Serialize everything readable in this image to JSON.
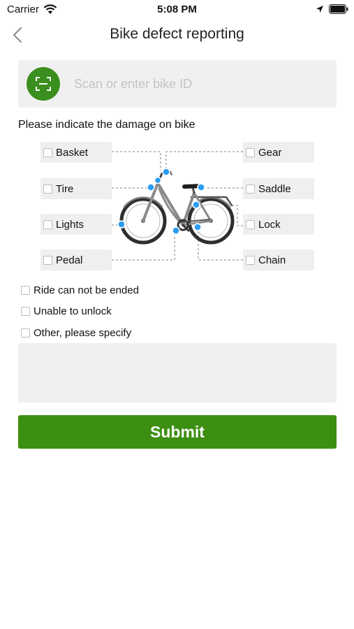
{
  "status_bar": {
    "carrier": "Carrier",
    "time": "5:08 PM",
    "icons": [
      "wifi-icon",
      "location-arrow-icon",
      "battery-icon"
    ]
  },
  "nav": {
    "title": "Bike defect reporting",
    "back_icon": "chevron-left-icon"
  },
  "scan": {
    "icon": "scan-icon",
    "placeholder": "Scan or enter bike ID",
    "value": ""
  },
  "damage": {
    "heading": "Please indicate the damage on bike",
    "parts_left": [
      {
        "label": "Basket",
        "checked": false
      },
      {
        "label": "Tire",
        "checked": false
      },
      {
        "label": "Lights",
        "checked": false
      },
      {
        "label": "Pedal",
        "checked": false
      }
    ],
    "parts_right": [
      {
        "label": "Gear",
        "checked": false
      },
      {
        "label": "Saddle",
        "checked": false
      },
      {
        "label": "Lock",
        "checked": false
      },
      {
        "label": "Chain",
        "checked": false
      }
    ]
  },
  "options": [
    {
      "label": "Ride can not be ended",
      "checked": false
    },
    {
      "label": "Unable to unlock",
      "checked": false
    },
    {
      "label": "Other, please specify",
      "checked": false
    }
  ],
  "other_text": {
    "value": ""
  },
  "submit_label": "Submit",
  "colors": {
    "accent": "#3d8f12",
    "marker": "#2a9df4",
    "box_bg": "#efefef"
  }
}
